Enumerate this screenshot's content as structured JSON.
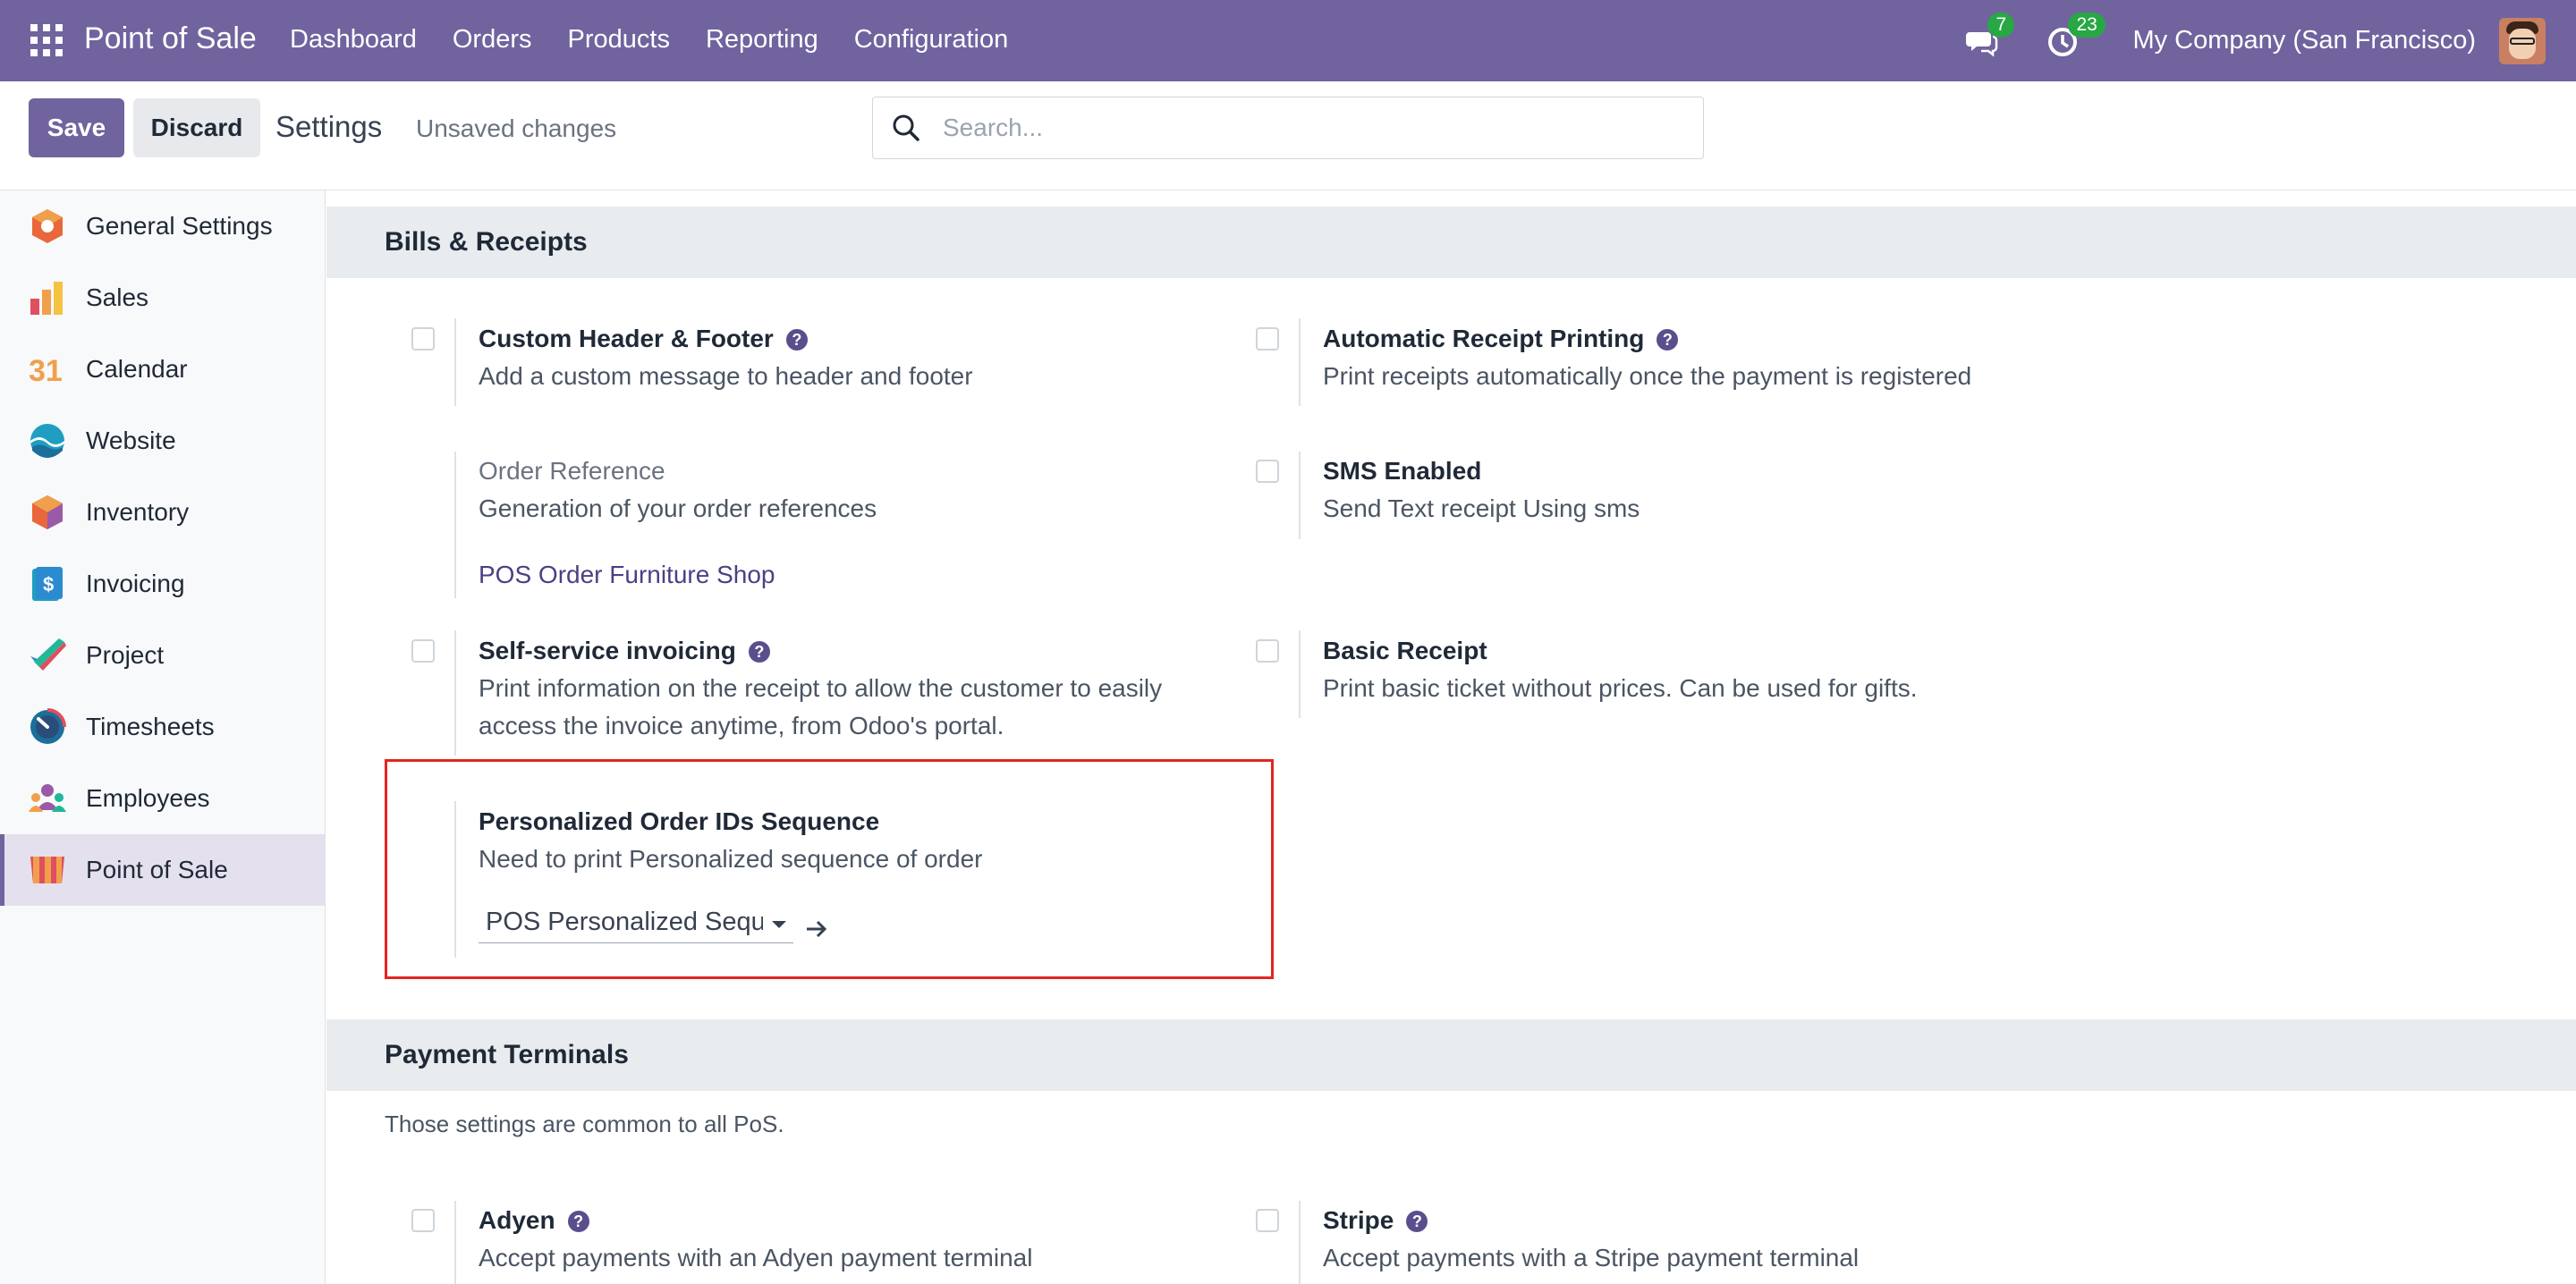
{
  "navbar": {
    "brand": "Point of Sale",
    "menu": [
      "Dashboard",
      "Orders",
      "Products",
      "Reporting",
      "Configuration"
    ],
    "messages_count": "7",
    "activities_count": "23",
    "company": "My Company (San Francisco)",
    "bg_color": "#71639e"
  },
  "control": {
    "save_label": "Save",
    "discard_label": "Discard",
    "title": "Settings",
    "status": "Unsaved changes",
    "search_placeholder": "Search..."
  },
  "sidebar": {
    "items": [
      {
        "label": "General Settings",
        "icon": "general-settings-icon"
      },
      {
        "label": "Sales",
        "icon": "sales-icon"
      },
      {
        "label": "Calendar",
        "icon": "calendar-icon",
        "icon_text": "31"
      },
      {
        "label": "Website",
        "icon": "website-icon"
      },
      {
        "label": "Inventory",
        "icon": "inventory-icon"
      },
      {
        "label": "Invoicing",
        "icon": "invoicing-icon",
        "icon_text": "$"
      },
      {
        "label": "Project",
        "icon": "project-icon"
      },
      {
        "label": "Timesheets",
        "icon": "timesheets-icon"
      },
      {
        "label": "Employees",
        "icon": "employees-icon"
      },
      {
        "label": "Point of Sale",
        "icon": "point-of-sale-icon",
        "active": true
      }
    ]
  },
  "sections": {
    "bills": {
      "title": "Bills & Receipts",
      "custom_header": {
        "title": "Custom Header & Footer",
        "desc": "Add a custom message to header and footer"
      },
      "auto_print": {
        "title": "Automatic Receipt Printing",
        "desc": "Print receipts automatically once the payment is registered"
      },
      "order_ref": {
        "title": "Order Reference",
        "desc": "Generation of your order references",
        "link": "POS Order Furniture Shop"
      },
      "sms": {
        "title": "SMS Enabled",
        "desc": "Send Text receipt Using sms"
      },
      "self_service": {
        "title": "Self-service invoicing",
        "desc_line1": "Print information on the receipt to allow the customer to easily",
        "desc_line2": "access the invoice anytime, from Odoo's portal."
      },
      "basic_receipt": {
        "title": "Basic Receipt",
        "desc": "Print basic ticket without prices. Can be used for gifts."
      },
      "personalized": {
        "title": "Personalized Order IDs Sequence",
        "desc": "Need to print Personalized sequence of order",
        "selected": "POS Personalized Sequence"
      }
    },
    "payment": {
      "title": "Payment Terminals",
      "note": "Those settings are common to all PoS.",
      "adyen": {
        "title": "Adyen",
        "desc": "Accept payments with an Adyen payment terminal"
      },
      "stripe": {
        "title": "Stripe",
        "desc": "Accept payments with a Stripe payment terminal"
      }
    }
  },
  "help_glyph": "?"
}
